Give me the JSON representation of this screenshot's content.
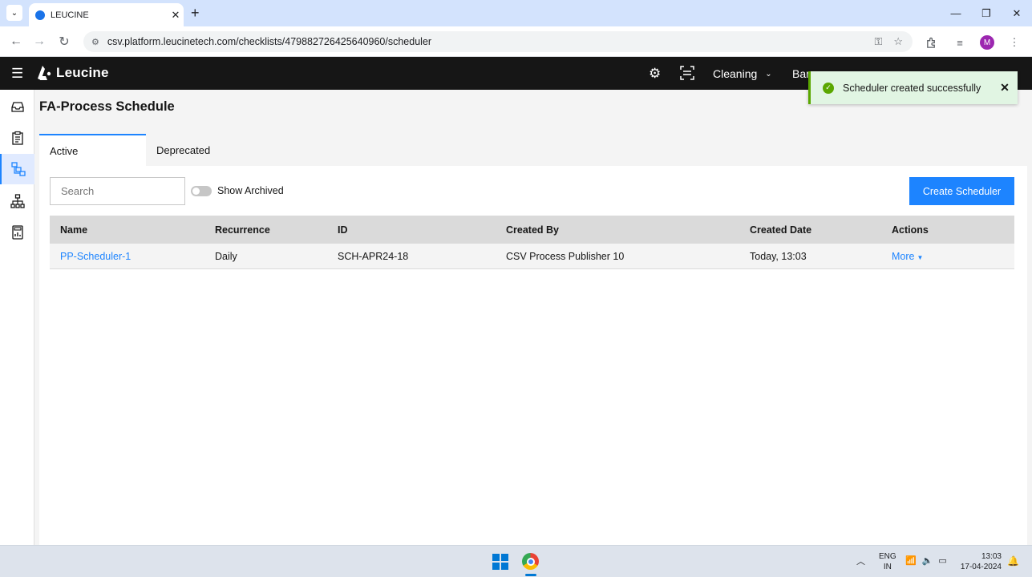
{
  "browser": {
    "tab_title": "LEUCINE",
    "tab_close": "✕",
    "new_tab": "+",
    "url": "csv.platform.leucinetech.com/checklists/479882726425640960/scheduler",
    "profile_initial": "M",
    "window_controls": {
      "minimize": "—",
      "restore": "❐",
      "close": "✕"
    }
  },
  "app_header": {
    "logo_text": "Leucine",
    "facility": "Cleaning",
    "truncated_text": "Bar..."
  },
  "page": {
    "title": "FA-Process Schedule",
    "tabs": [
      {
        "label": "Active"
      },
      {
        "label": "Deprecated"
      }
    ],
    "search_placeholder": "Search",
    "show_archived_label": "Show Archived",
    "create_button_label": "Create Scheduler"
  },
  "table": {
    "columns": [
      "Name",
      "Recurrence",
      "ID",
      "Created By",
      "Created Date",
      "Actions"
    ],
    "rows": [
      {
        "name": "PP-Scheduler-1",
        "recurrence": "Daily",
        "id": "SCH-APR24-18",
        "created_by": "CSV Process Publisher 10",
        "created_date": "Today, 13:03",
        "actions": "More"
      }
    ]
  },
  "toast": {
    "message": "Scheduler created successfully",
    "status": "success"
  },
  "taskbar": {
    "lang_line1": "ENG",
    "lang_line2": "IN",
    "time": "13:03",
    "date": "17-04-2024"
  },
  "colors": {
    "primary": "#1d84ff",
    "header_bg": "#161616",
    "success": "#5aa700",
    "toast_bg": "#e1f5e3"
  }
}
